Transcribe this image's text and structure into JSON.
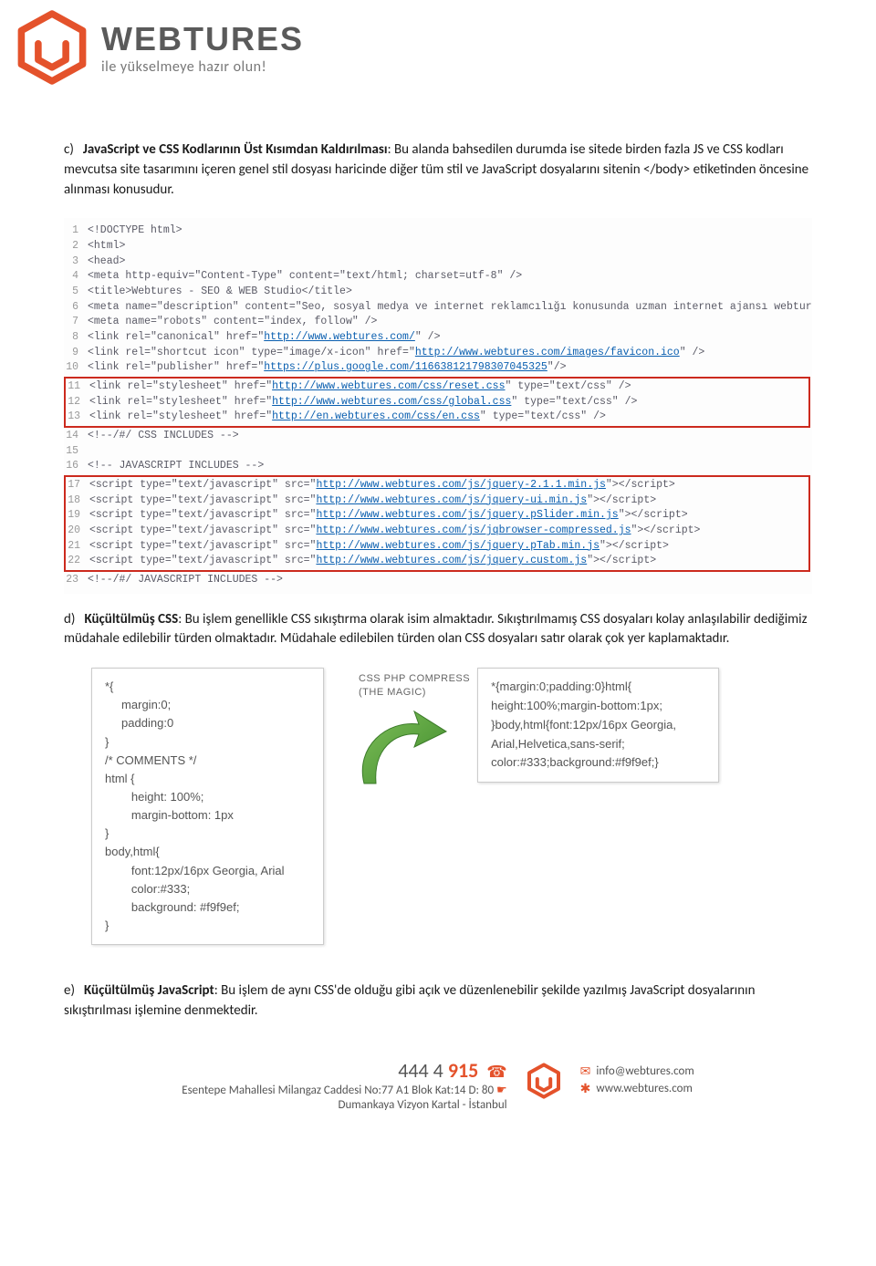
{
  "header": {
    "brand": "WEBTURES",
    "tagline": "ile yükselmeye hazır olun!"
  },
  "sections": {
    "c": {
      "marker": "c)",
      "title": "JavaScript ve CSS Kodlarının Üst Kısımdan Kaldırılması",
      "body": ": Bu alanda bahsedilen durumda ise sitede birden fazla JS ve CSS kodları mevcutsa site tasarımını içeren genel stil dosyası haricinde diğer tüm stil ve JavaScript dosyalarını sitenin </body> etiketinden öncesine alınması konusudur."
    },
    "d": {
      "marker": "d)",
      "title": "Küçültülmüş CSS",
      "body": ": Bu işlem genellikle CSS sıkıştırma olarak isim almaktadır. Sıkıştırılmamış CSS dosyaları kolay anlaşılabilir dediğimiz müdahale edilebilir türden olmaktadır. Müdahale edilebilen türden olan CSS dosyaları satır olarak çok yer kaplamaktadır."
    },
    "e": {
      "marker": "e)",
      "title": "Küçültülmüş JavaScript",
      "body": ": Bu işlem de aynı CSS'de olduğu gibi açık ve düzenlenebilir şekilde yazılmış JavaScript dosyalarının sıkıştırılması işlemine denmektedir."
    }
  },
  "code1": {
    "l1": "<!DOCTYPE html>",
    "l2": "<html>",
    "l3": "<head>",
    "l4": "<meta http-equiv=\"Content-Type\" content=\"text/html; charset=utf-8\" />",
    "l5": "<title>Webtures - SEO & WEB Studio</title>",
    "l6": "<meta name=\"description\" content=\"Seo, sosyal medya ve internet reklamcılığı konusunda uzman internet ajansı webtures.\" />",
    "l7": "<meta name=\"robots\" content=\"index, follow\" />",
    "l8_a": "<link rel=\"canonical\" href=\"",
    "l8_url": "http://www.webtures.com/",
    "l8_b": "\" />",
    "l9_a": "<link rel=\"shortcut icon\" type=\"image/x-icon\" href=\"",
    "l9_url": "http://www.webtures.com/images/favicon.ico",
    "l9_b": "\" />",
    "l10_a": "<link rel=\"publisher\" href=\"",
    "l10_url": "https://plus.google.com/116638121798307045325",
    "l10_b": "\"/>",
    "l11_a": "<link rel=\"stylesheet\" href=\"",
    "l11_url": "http://www.webtures.com/css/reset.css",
    "l11_b": "\" type=\"text/css\" />",
    "l12_a": "<link rel=\"stylesheet\" href=\"",
    "l12_url": "http://www.webtures.com/css/global.css",
    "l12_b": "\" type=\"text/css\" />",
    "l13_a": "<link rel=\"stylesheet\" href=\"",
    "l13_url": "http://en.webtures.com/css/en.css",
    "l13_b": "\" type=\"text/css\" />",
    "l14": "<!--/#/ CSS INCLUDES -->",
    "l15": "",
    "l16": "<!-- JAVASCRIPT INCLUDES -->",
    "l17_a": "<script type=\"text/javascript\" src=\"",
    "l17_url": "http://www.webtures.com/js/jquery-2.1.1.min.js",
    "l17_b": "\"></script>",
    "l18_a": "<script type=\"text/javascript\" src=\"",
    "l18_url": "http://www.webtures.com/js/jquery-ui.min.js",
    "l18_b": "\"></script>",
    "l19_a": "<script type=\"text/javascript\" src=\"",
    "l19_url": "http://www.webtures.com/js/jquery.pSlider.min.js",
    "l19_b": "\"></script>",
    "l20_a": "<script type=\"text/javascript\" src=\"",
    "l20_url": "http://www.webtures.com/js/jqbrowser-compressed.js",
    "l20_b": "\"></script>",
    "l21_a": "<script type=\"text/javascript\" src=\"",
    "l21_url": "http://www.webtures.com/js/jquery.pTab.min.js",
    "l21_b": "\"></script>",
    "l22_a": "<script type=\"text/javascript\" src=\"",
    "l22_url": "http://www.webtures.com/js/jquery.custom.js",
    "l22_b": "\"></script>",
    "l23": "<!--/#/ JAVASCRIPT INCLUDES -->"
  },
  "cssfig": {
    "left": "*{\n     margin:0;\n     padding:0\n}\n/* COMMENTS */\nhtml {\n        height: 100%;\n        margin-bottom: 1px\n}\nbody,html{\n        font:12px/16px Georgia, Arial\n        color:#333;\n        background: #f9f9ef;\n}",
    "label": "CSS PHP COMPRESS\n(THE MAGIC)",
    "right": "*{margin:0;padding:0}html{\nheight:100%;margin-bottom:1px;\n}body,html{font:12px/16px Georgia,\nArial,Helvetica,sans-serif;\ncolor:#333;background:#f9f9ef;}"
  },
  "footer": {
    "phone_pre": "444 4 ",
    "phone_main": "915",
    "phone_icon": "☎",
    "phone_hint": "☛",
    "addr1": "Esentepe Mahallesi Milangaz Caddesi No:77 A1 Blok Kat:14 D: 80",
    "addr2": "Dumankaya Vizyon Kartal - İstanbul",
    "email": "info@webtures.com",
    "site": "www.webtures.com"
  }
}
